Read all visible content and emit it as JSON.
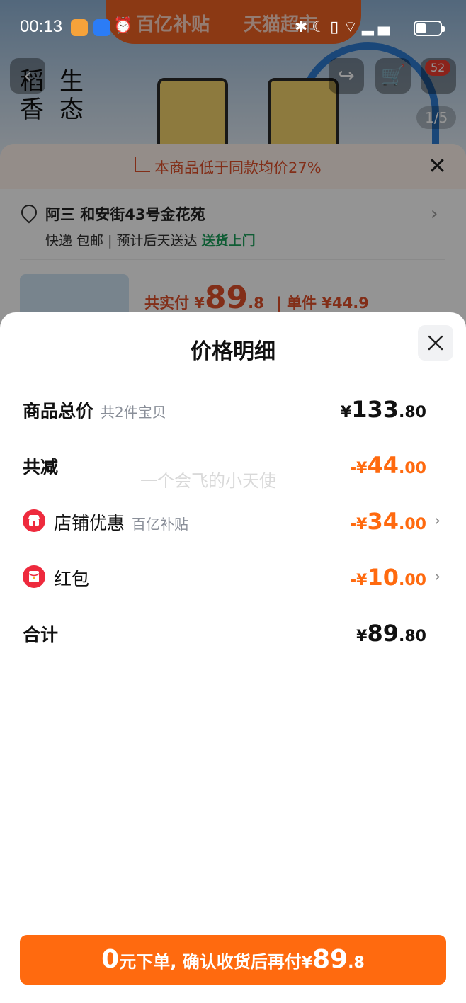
{
  "status_bar": {
    "time": "00:13",
    "battery_level": 0.4
  },
  "background": {
    "banner_left": "百亿补贴",
    "banner_right": "天猫超市",
    "poster_left": "稻\n香",
    "poster_right": "生\n态",
    "cart_count": "52",
    "image_counter": "1/5",
    "promo_text": "本商品低于同款均价27%",
    "address_line": "阿三 和安街43号金花苑",
    "delivery_text": "快递 包邮 | 预计后天送达",
    "delivery_highlight": "送货上门",
    "paid_prefix": "共实付 ¥",
    "paid_int": "89",
    "paid_dec": ".8",
    "unit_price": "| 单件 ¥44.9"
  },
  "sheet": {
    "title": "价格明细",
    "watermark": "一个会飞的小天使",
    "rows": [
      {
        "label": "商品总价",
        "sub": "共2件宝贝",
        "currency": "¥",
        "int": "133",
        "dec": ".80"
      },
      {
        "label": "共减",
        "sub": "",
        "currency": "-¥",
        "int": "44",
        "dec": ".00"
      },
      {
        "label": "店铺优惠",
        "sub": "百亿补贴",
        "currency": "-¥",
        "int": "34",
        "dec": ".00"
      },
      {
        "label": "红包",
        "sub": "",
        "currency": "-¥",
        "int": "10",
        "dec": ".00"
      },
      {
        "label": "合计",
        "sub": "",
        "currency": "¥",
        "int": "89",
        "dec": ".80"
      }
    ]
  },
  "cta": {
    "zero": "0",
    "text": "元下单, 确认收货后再付",
    "currency": "¥",
    "int": "89",
    "dec": ".8"
  },
  "colors": {
    "accent_orange": "#ff6a0f",
    "shop_red": "#ee2a3d",
    "delivery_green": "#1a9f5a"
  }
}
